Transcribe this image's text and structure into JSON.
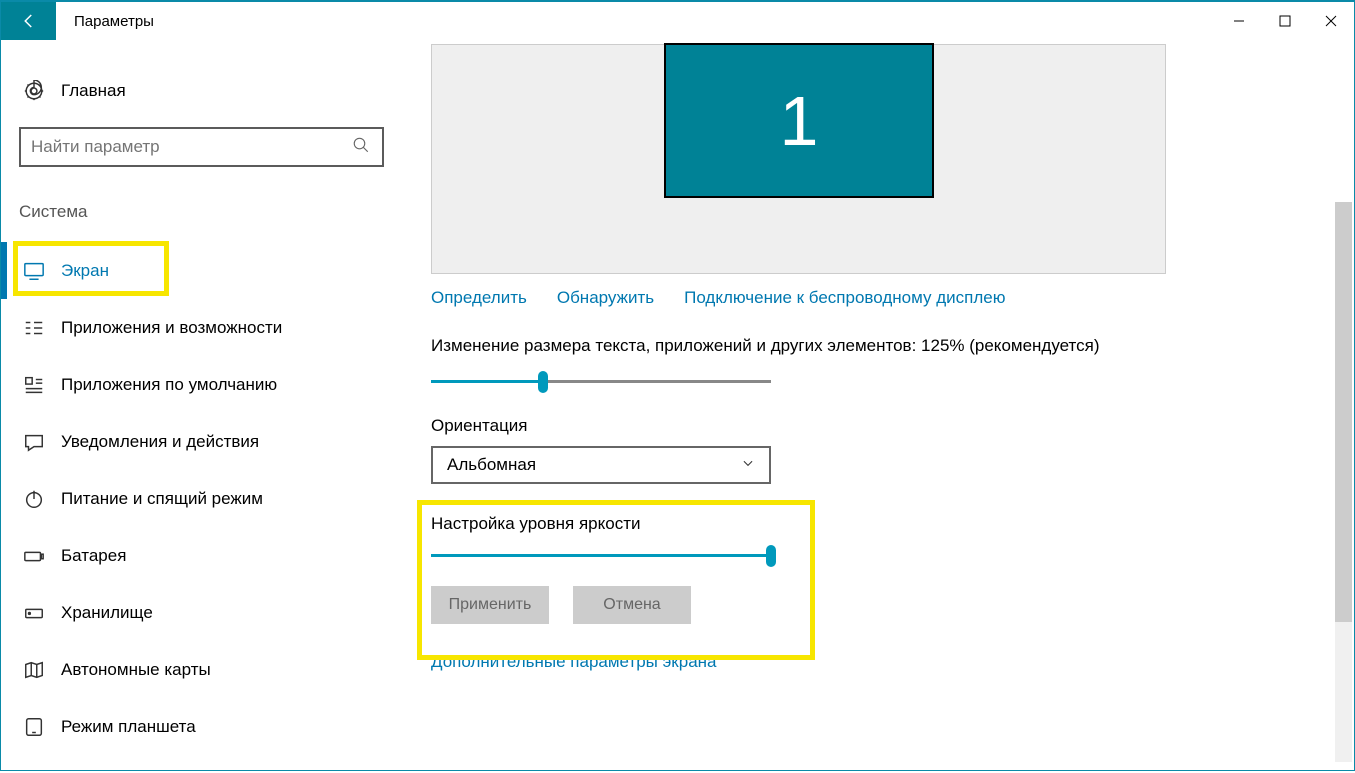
{
  "window": {
    "title": "Параметры"
  },
  "sidebar": {
    "home": "Главная",
    "search_placeholder": "Найти параметр",
    "section": "Система",
    "items": [
      {
        "label": "Экран"
      },
      {
        "label": "Приложения и возможности"
      },
      {
        "label": "Приложения по умолчанию"
      },
      {
        "label": "Уведомления и действия"
      },
      {
        "label": "Питание и спящий режим"
      },
      {
        "label": "Батарея"
      },
      {
        "label": "Хранилище"
      },
      {
        "label": "Автономные карты"
      },
      {
        "label": "Режим планшета"
      }
    ]
  },
  "main": {
    "monitor_number": "1",
    "links": {
      "identify": "Определить",
      "detect": "Обнаружить",
      "wireless": "Подключение к беспроводному дисплею"
    },
    "scale_label": "Изменение размера текста, приложений и других элементов: 125% (рекомендуется)",
    "scale_value_percent": 33,
    "orientation_label": "Ориентация",
    "orientation_value": "Альбомная",
    "brightness_label": "Настройка уровня яркости",
    "brightness_value_percent": 100,
    "apply_btn": "Применить",
    "cancel_btn": "Отмена",
    "advanced_link": "Дополнительные параметры экрана"
  }
}
